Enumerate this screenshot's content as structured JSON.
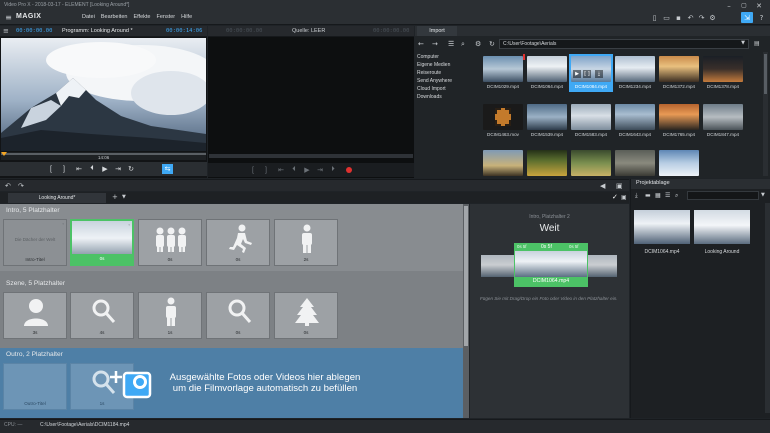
{
  "app": {
    "logo": "MAGIX",
    "title_text": "Video Pro X - 2018-03-17 - ELEMENT [Looking Around*]",
    "menu": [
      "Datei",
      "Bearbeiten",
      "Effekte",
      "Fenster",
      "Hilfe"
    ]
  },
  "program_monitor": {
    "timecode_left": "00:00:00.00",
    "title": "Programm: Looking Around *",
    "timecode_right": "00:00:14:06",
    "scrub_time": "14:06"
  },
  "source_monitor": {
    "timecode_left": "00:00:00.00",
    "title": "Quelle: LEER",
    "timecode_right": "00:00:00.00"
  },
  "import": {
    "tab": "Import",
    "path": "C:\\User\\Footage\\Aerials",
    "nav_items": [
      "Computer",
      "Eigene Medien",
      "Reiseroute",
      "Send Anywhere",
      "Cloud Import",
      "Downloads"
    ],
    "files_row1": [
      "DCIM1029.mp4",
      "DCIM1064.mp4",
      "DCIM1084.mp4",
      "DCIM1234.mp4",
      "DCIM1372.mp4",
      "DCIM1378.mp4"
    ],
    "files_row2": [
      "DCIM1463.mov",
      "DCIM1539.mp4",
      "DCIM1583.mp4",
      "DCIM1643.mp4",
      "DCIM1765.mp4",
      "DCIM1847.mp4"
    ]
  },
  "storyboard": {
    "tab": "Looking Around*",
    "intro_title": "Intro, 5 Platzhalter",
    "szene_title": "Szene, 5 Platzhalter",
    "outro_title": "Outro, 2 Platzhalter",
    "intro_slots": [
      {
        "label": "Intro-Titel",
        "placeholder": "Die Dächer der Welt"
      },
      {
        "label": "0s"
      },
      {
        "label": "0s"
      },
      {
        "label": "0s"
      },
      {
        "label": "2s"
      }
    ],
    "szene_slots": [
      {
        "label": "3s"
      },
      {
        "label": "4s"
      },
      {
        "label": "1s"
      },
      {
        "label": "0s"
      },
      {
        "label": "0s"
      }
    ],
    "outro_slots": [
      {
        "label": "Outro-Titel"
      },
      {
        "label": "1s"
      }
    ],
    "drop_hint_line1": "Ausgewählte Fotos oder Videos hier ablegen",
    "drop_hint_line2": "um die Filmvorlage automatisch zu befüllen"
  },
  "detail": {
    "subtitle": "Intro, Platzhalter 2",
    "name": "Weit",
    "time_left": "0s 5f",
    "time_center": "0s 5f",
    "time_right": "0s 5f",
    "clip_name": "DCIM1064.mp4",
    "hint": "Fügen Sie mit Drag/Drop ein Foto oder Video in den Platzhalter ein."
  },
  "projektablage": {
    "title": "Projektablage",
    "items": [
      "DCIM1064.mp4",
      "Looking Around"
    ]
  },
  "statusbar": {
    "cpu": "CPU: —",
    "path": "C:\\User\\Footage\\Aerials\\DCIM1184.mp4"
  },
  "colors": {
    "accent_blue": "#3fa9f5",
    "selection_green": "#4cc266",
    "outro_blue": "#4e7fa6"
  }
}
